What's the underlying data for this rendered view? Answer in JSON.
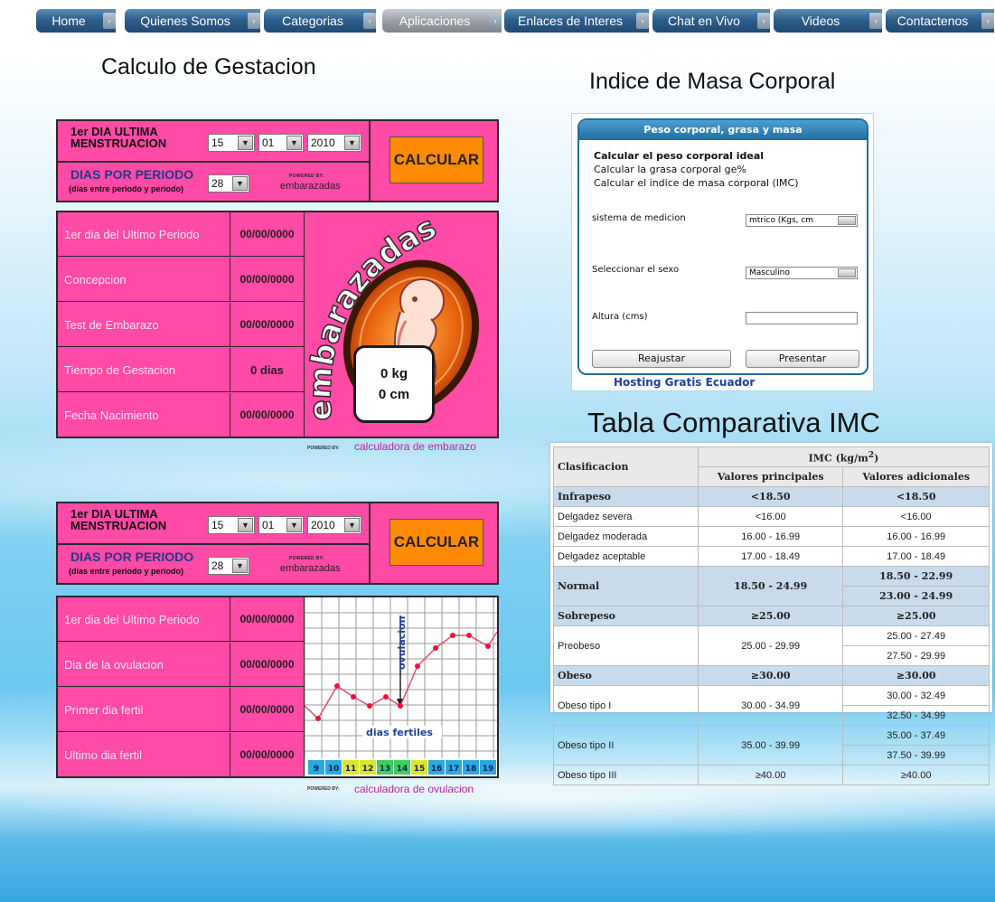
{
  "nav": {
    "items": [
      {
        "label": "Home",
        "active": false
      },
      {
        "label": "Quienes Somos",
        "active": false
      },
      {
        "label": "Categorias",
        "active": false
      },
      {
        "label": "Aplicaciones",
        "active": true
      },
      {
        "label": "Enlaces de Interes",
        "active": false
      },
      {
        "label": "Chat en Vivo",
        "active": false
      },
      {
        "label": "Videos",
        "active": false
      },
      {
        "label": "Contactenos",
        "active": false
      }
    ]
  },
  "gestation": {
    "title": "Calculo de Gestacion",
    "form": {
      "last_period_label_1": "1er DIA ULTIMA",
      "last_period_label_2": "MENSTRUACION",
      "day": "15",
      "month": "01",
      "year": "2010",
      "cycle_label": "DIAS POR PERIODO",
      "cycle_sub": "(dias entre periodo y periodo)",
      "cycle_value": "28",
      "calc_button": "CALCULAR",
      "powered_by": "POWERED BY:",
      "brand": "embarazadas"
    },
    "rows": [
      {
        "label": "1er dia del Ultimo Periodo",
        "value": "00/00/0000"
      },
      {
        "label": "Concepcion",
        "value": "00/00/0000"
      },
      {
        "label": "Test de Embarazo",
        "value": "00/00/0000"
      },
      {
        "label": "Tiempo de Gestacion",
        "value": "0 dias"
      },
      {
        "label": "Fecha Nacimiento",
        "value": "00/00/0000"
      }
    ],
    "art_text": "embarazadas",
    "weight": "0 kg",
    "length": "0 cm",
    "footer_powered": "POWERED BY:",
    "footer_link": "calculadora de embarazo"
  },
  "ovulation": {
    "form": {
      "last_period_label_1": "1er DIA ULTIMA",
      "last_period_label_2": "MENSTRUACION",
      "day": "15",
      "month": "01",
      "year": "2010",
      "cycle_label": "DIAS POR PERIODO",
      "cycle_sub": "(dias entre periodo y periodo)",
      "cycle_value": "28",
      "calc_button": "CALCULAR",
      "powered_by": "POWERED BY:",
      "brand": "embarazadas"
    },
    "rows": [
      {
        "label": "1er dia del Ultimo Periodo",
        "value": "00/00/0000"
      },
      {
        "label": "Dia de la ovulacion",
        "value": "00/00/0000"
      },
      {
        "label": "Primer dia fertil",
        "value": "00/00/0000"
      },
      {
        "label": "Ultimo dia fertil",
        "value": "00/00/0000"
      }
    ],
    "chart": {
      "ovulation_label": "ovulacion",
      "fertile_label": "dias fertiles",
      "days": [
        "9",
        "10",
        "11",
        "12",
        "13",
        "14",
        "15",
        "16",
        "17",
        "18",
        "19"
      ],
      "day_colors": [
        "#2aa9e0",
        "#2aa9e0",
        "#d9e62a",
        "#d9e62a",
        "#3fd05a",
        "#3fd05a",
        "#d9e62a",
        "#2aa9e0",
        "#2aa9e0",
        "#2aa9e0",
        "#2aa9e0"
      ]
    },
    "footer_powered": "POWERED BY:",
    "footer_link": "calculadora de ovulacion"
  },
  "imc": {
    "title": "Indice de Masa Corporal",
    "widget_header": "Peso corporal, grasa y masa",
    "links": [
      "Calcular el peso corporal ideal",
      "Calcular la grasa corporal ge%",
      "Calcular el indice de masa corporal (IMC)"
    ],
    "system_label": "sistema de medicion",
    "system_value": "mtrico (Kgs, cm",
    "sex_label": "Seleccionar el sexo",
    "sex_value": "Masculino",
    "height_label": "Altura (cms)",
    "height_value": "",
    "reset_button": "Reajustar",
    "submit_button": "Presentar",
    "hosting_link": "Hosting Gratis Ecuador"
  },
  "imc_table": {
    "title": "Tabla Comparativa IMC",
    "col_class": "Clasificacion",
    "col_imc": "IMC (kg/m",
    "col_imc_sup": "2",
    "col_imc_close": ")",
    "col_main": "Valores principales",
    "col_extra": "Valores adicionales",
    "rows": [
      {
        "type": "cat",
        "label": "Infrapeso",
        "main": "<18.50",
        "extra": [
          "<18.50"
        ]
      },
      {
        "type": "sub",
        "label": "Delgadez severa",
        "main": "<16.00",
        "extra": [
          "<16.00"
        ]
      },
      {
        "type": "sub",
        "label": "Delgadez moderada",
        "main": "16.00 - 16.99",
        "extra": [
          "16.00 - 16.99"
        ]
      },
      {
        "type": "sub",
        "label": "Delgadez aceptable",
        "main": "17.00 - 18.49",
        "extra": [
          "17.00 - 18.49"
        ]
      },
      {
        "type": "cat",
        "label": "Normal",
        "main": "18.50 - 24.99",
        "extra": [
          "18.50 - 22.99",
          "23.00 - 24.99"
        ]
      },
      {
        "type": "cat",
        "label": "Sobrepeso",
        "main": "≥25.00",
        "extra": [
          "≥25.00"
        ]
      },
      {
        "type": "sub",
        "label": "Preobeso",
        "main": "25.00 - 29.99",
        "extra": [
          "25.00 - 27.49",
          "27.50 - 29.99"
        ]
      },
      {
        "type": "cat",
        "label": "Obeso",
        "main": "≥30.00",
        "extra": [
          "≥30.00"
        ]
      },
      {
        "type": "sub",
        "label": "Obeso tipo I",
        "main": "30.00 - 34.99",
        "extra": [
          "30.00 - 32.49",
          "32.50 - 34.99"
        ]
      },
      {
        "type": "sub",
        "label": "Obeso tipo II",
        "main": "35.00 - 39.99",
        "extra": [
          "35.00 - 37.49",
          "37.50 - 39.99"
        ]
      },
      {
        "type": "sub",
        "label": "Obeso tipo III",
        "main": "≥40.00",
        "extra": [
          "≥40.00"
        ]
      }
    ]
  },
  "colors": {
    "pink": "#ff4aa6",
    "orange": "#ff8a05",
    "nav_blue": "#2e5f8c",
    "nav_active": "#9aa0a6",
    "table_highlight": "#c7dbec"
  }
}
